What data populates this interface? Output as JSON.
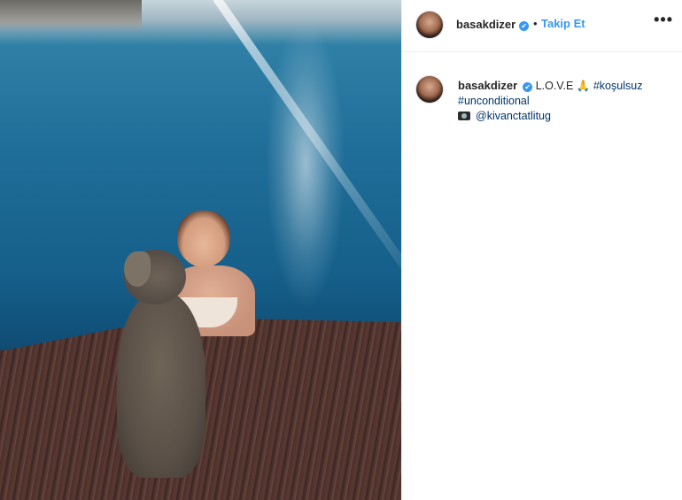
{
  "post": {
    "username": "basakdizer",
    "follow_label": "Takip Et",
    "separator": "•",
    "more_label": "•••",
    "verified_icon": "✔"
  },
  "caption": {
    "username": "basakdizer",
    "text": "L.O.V.E",
    "pray_emoji": "🙏",
    "hashtag_1": "#koşulsuz",
    "hashtag_2": "#unconditional",
    "mention": "@kivanctatlitug"
  }
}
